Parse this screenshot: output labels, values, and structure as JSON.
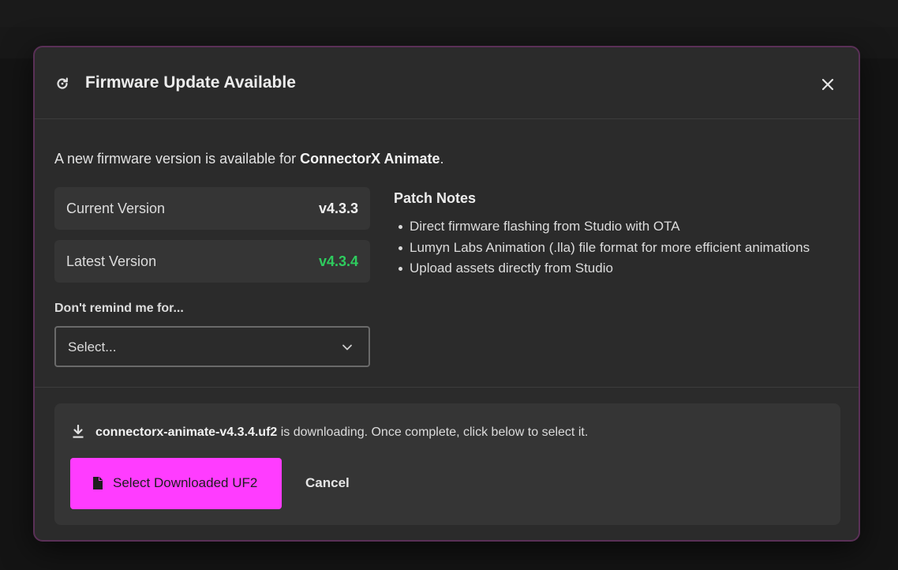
{
  "modal": {
    "title": "Firmware Update Available",
    "intro_prefix": "A new firmware version is available for ",
    "device_name": "ConnectorX Animate",
    "intro_suffix": ".",
    "current_version_label": "Current Version",
    "current_version_value": "v4.3.3",
    "latest_version_label": "Latest Version",
    "latest_version_value": "v4.3.4",
    "remind_label": "Don't remind me for...",
    "remind_select_value": "Select...",
    "patch_notes_title": "Patch Notes",
    "patch_notes": [
      "Direct firmware flashing from Studio with OTA",
      "Lumyn Labs Animation (.lla) file format for more efficient animations",
      "Upload assets directly from Studio"
    ],
    "download": {
      "filename": "connectorx-animate-v4.3.4.uf2",
      "message": " is downloading. Once complete, click below to select it.",
      "select_button_label": "Select Downloaded UF2",
      "cancel_button_label": "Cancel"
    }
  },
  "icons": {
    "header": "refresh-icon",
    "close": "close-icon",
    "select": "chevron-down-icon",
    "download": "download-icon",
    "file": "file-icon"
  },
  "colors": {
    "accent": "#ff3cff",
    "latest_version": "#2ecc5e",
    "modal_border": "#5a3057"
  }
}
